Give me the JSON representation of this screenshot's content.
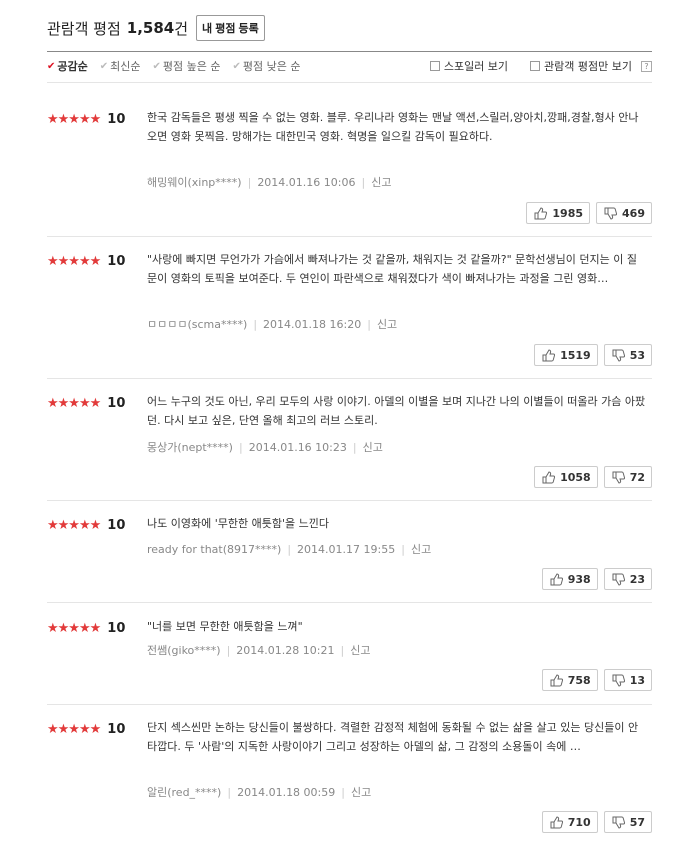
{
  "header": {
    "title": "관람객 평점",
    "count": "1,584",
    "unit": "건",
    "write_button": "내 평점 등록"
  },
  "filters": {
    "sort": [
      {
        "label": "공감순",
        "active": true
      },
      {
        "label": "최신순",
        "active": false
      },
      {
        "label": "평점 높은 순",
        "active": false
      },
      {
        "label": "평점 낮은 순",
        "active": false
      }
    ],
    "options": [
      {
        "label": "스포일러 보기"
      },
      {
        "label": "관람객 평점만 보기"
      }
    ],
    "help": "?"
  },
  "colors": {
    "star": "#e23a3a",
    "check_active": "#dd1122"
  },
  "reviews": [
    {
      "rating": "10",
      "text": "한국 감독들은 평생 찍을 수 없는 영화. 블루. 우리나라 영화는 맨날 액션,스릴러,양아치,깡패,경찰,형사 안나오면 영화 못찍음. 망해가는 대한민국 영화. 혁명을 일으킬 감독이 필요하다.",
      "user": "해밍웨이(xinp****)",
      "date": "2014.01.16 10:06",
      "report": "신고",
      "likes": "1985",
      "dislikes": "469"
    },
    {
      "rating": "10",
      "text": "\"사랑에 빠지면 무언가가 가슴에서 빠져나가는 것 같을까, 채워지는 것 같을까?\" 문학선생님이 던지는 이 질문이 영화의 토픽을 보여준다. 두 연인이 파란색으로 채워졌다가 색이 빠져나가는 과정을 그린 영화…",
      "user": "ㅁㅁㅁㅁ(scma****)",
      "date": "2014.01.18 16:20",
      "report": "신고",
      "likes": "1519",
      "dislikes": "53"
    },
    {
      "rating": "10",
      "text": "어느 누구의 것도 아닌, 우리 모두의 사랑 이야기. 아델의 이별을 보며 지나간 나의 이별들이 떠올라 가슴 아팠던. 다시 보고 싶은, 단연 올해 최고의 러브 스토리.",
      "user": "몽상가(nept****)",
      "date": "2014.01.16 10:23",
      "report": "신고",
      "likes": "1058",
      "dislikes": "72"
    },
    {
      "rating": "10",
      "text": "나도 이영화에 '무한한 애틋함'을 느낀다",
      "user": "ready for that(8917****)",
      "date": "2014.01.17 19:55",
      "report": "신고",
      "likes": "938",
      "dislikes": "23"
    },
    {
      "rating": "10",
      "text": "\"너를 보면 무한한 애틋함을 느껴\"",
      "user": "전쌤(giko****)",
      "date": "2014.01.28 10:21",
      "report": "신고",
      "likes": "758",
      "dislikes": "13"
    },
    {
      "rating": "10",
      "text": "단지 섹스씬만 논하는 당신들이 불쌍하다. 격렬한 감정적 체험에 동화될 수 없는 삶을 살고 있는 당신들이 안타깝다. 두 '사람'의 지독한 사랑이야기 그리고 성장하는 아델의 삶, 그 감정의 소용돌이 속에 …",
      "user": "알린(red_****)",
      "date": "2014.01.18 00:59",
      "report": "신고",
      "likes": "710",
      "dislikes": "57"
    }
  ]
}
